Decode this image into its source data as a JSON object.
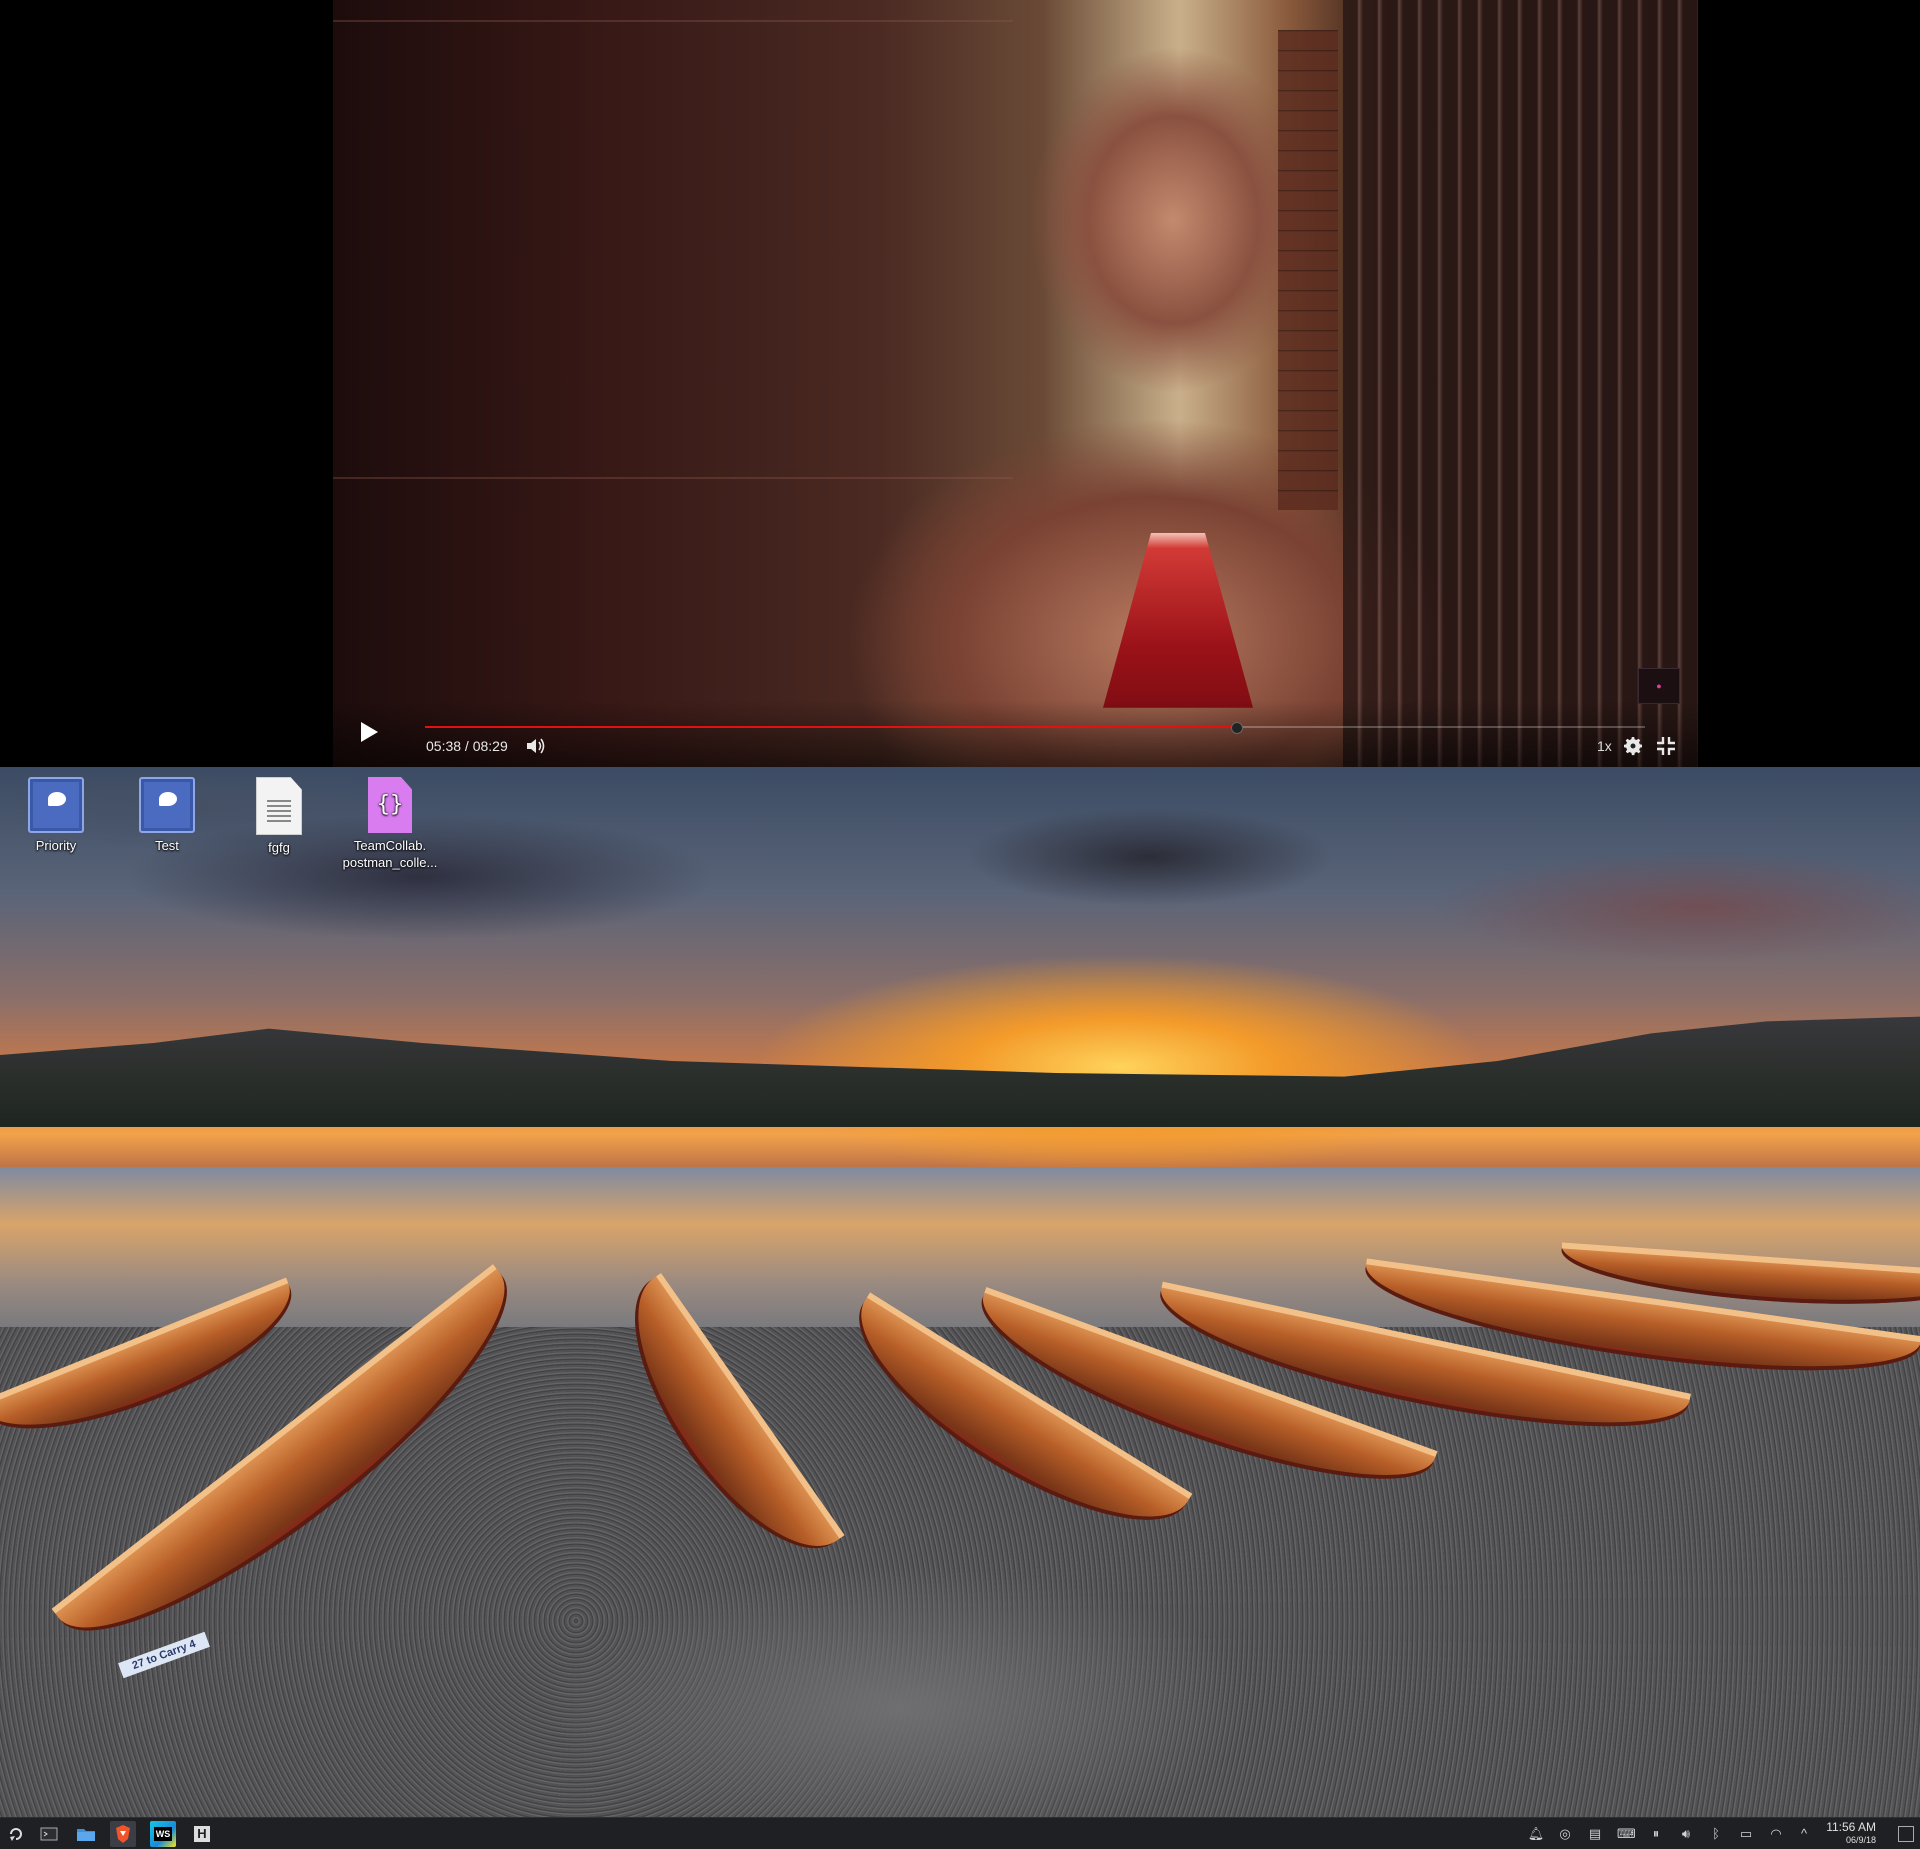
{
  "player": {
    "time_display": "05:38 / 08:29",
    "speed": "1x",
    "progress_fraction": 0.665,
    "icons": {
      "play": "play-icon",
      "volume": "volume-icon",
      "settings": "gear-icon",
      "fullscreen": "exit-fullscreen-icon"
    },
    "colors": {
      "progress": "#e11111",
      "text": "#e8e8e8"
    }
  },
  "desktop": {
    "icons": [
      {
        "label": "Priority",
        "type": "ticket-icon"
      },
      {
        "label": "Test",
        "type": "ticket-icon"
      },
      {
        "label": "fgfg",
        "type": "text-file-icon"
      },
      {
        "label": "TeamCollab.\npostman_colle...",
        "type": "json-file-icon",
        "glyph": "{}"
      }
    ],
    "wallpaper_text": "27 to Carry 4"
  },
  "taskbar": {
    "launchers": [
      {
        "name": "app-launcher-icon"
      },
      {
        "name": "terminal-icon"
      },
      {
        "name": "file-manager-icon"
      },
      {
        "name": "browser-icon"
      },
      {
        "name": "webstorm-icon",
        "text": "WS"
      },
      {
        "name": "app-h-icon",
        "text": "H"
      }
    ],
    "tray": [
      "notification-icon",
      "update-icon",
      "clipboard-icon",
      "keyboard-icon",
      "pause-icon",
      "volume-icon",
      "bluetooth-icon",
      "display-icon",
      "wifi-icon",
      "expand-tray-icon"
    ],
    "clock": {
      "time": "11:56 AM",
      "date": "06/9/18"
    }
  }
}
